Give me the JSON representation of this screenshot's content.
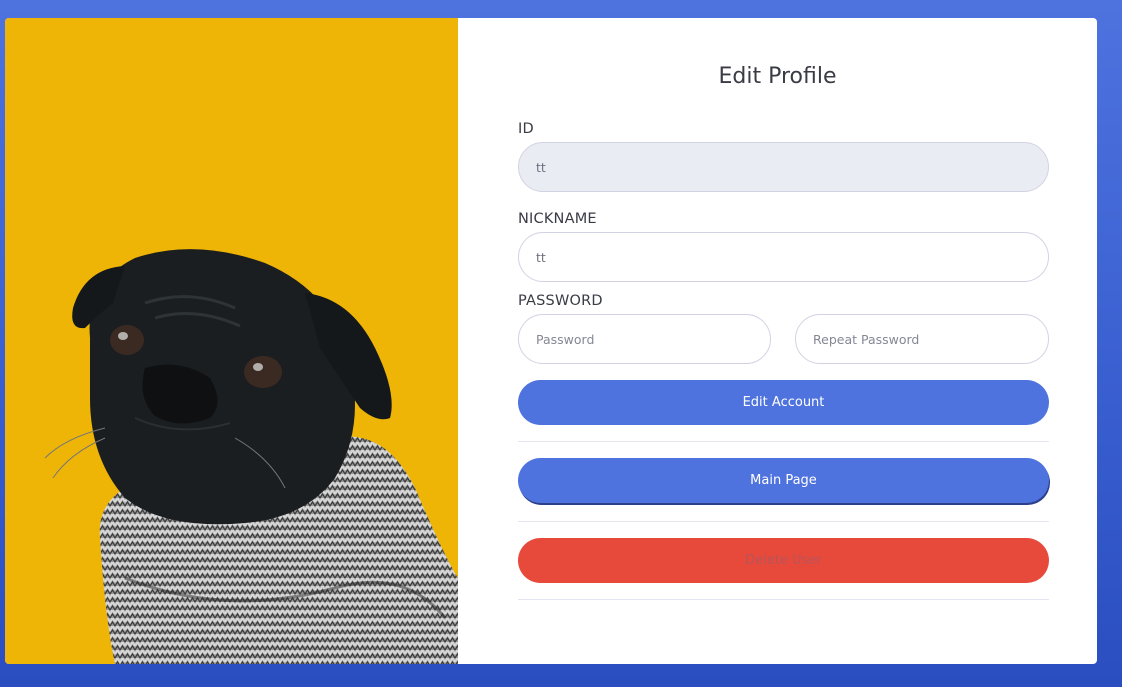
{
  "form": {
    "title": "Edit Profile",
    "id_label": "ID",
    "id_value": "tt",
    "nickname_label": "NICKNAME",
    "nickname_value": "tt",
    "password_label": "PASSWORD",
    "password_placeholder": "Password",
    "repeat_password_placeholder": "Repeat Password"
  },
  "buttons": {
    "edit_account": "Edit Account",
    "main_page": "Main Page",
    "delete_user": "Delete User"
  },
  "image": {
    "subject": "pug-in-sweater-photo"
  },
  "colors": {
    "background": "#4e73df",
    "primary": "#4e73df",
    "danger": "#e74a3b",
    "photo_background": "#eeb506"
  }
}
